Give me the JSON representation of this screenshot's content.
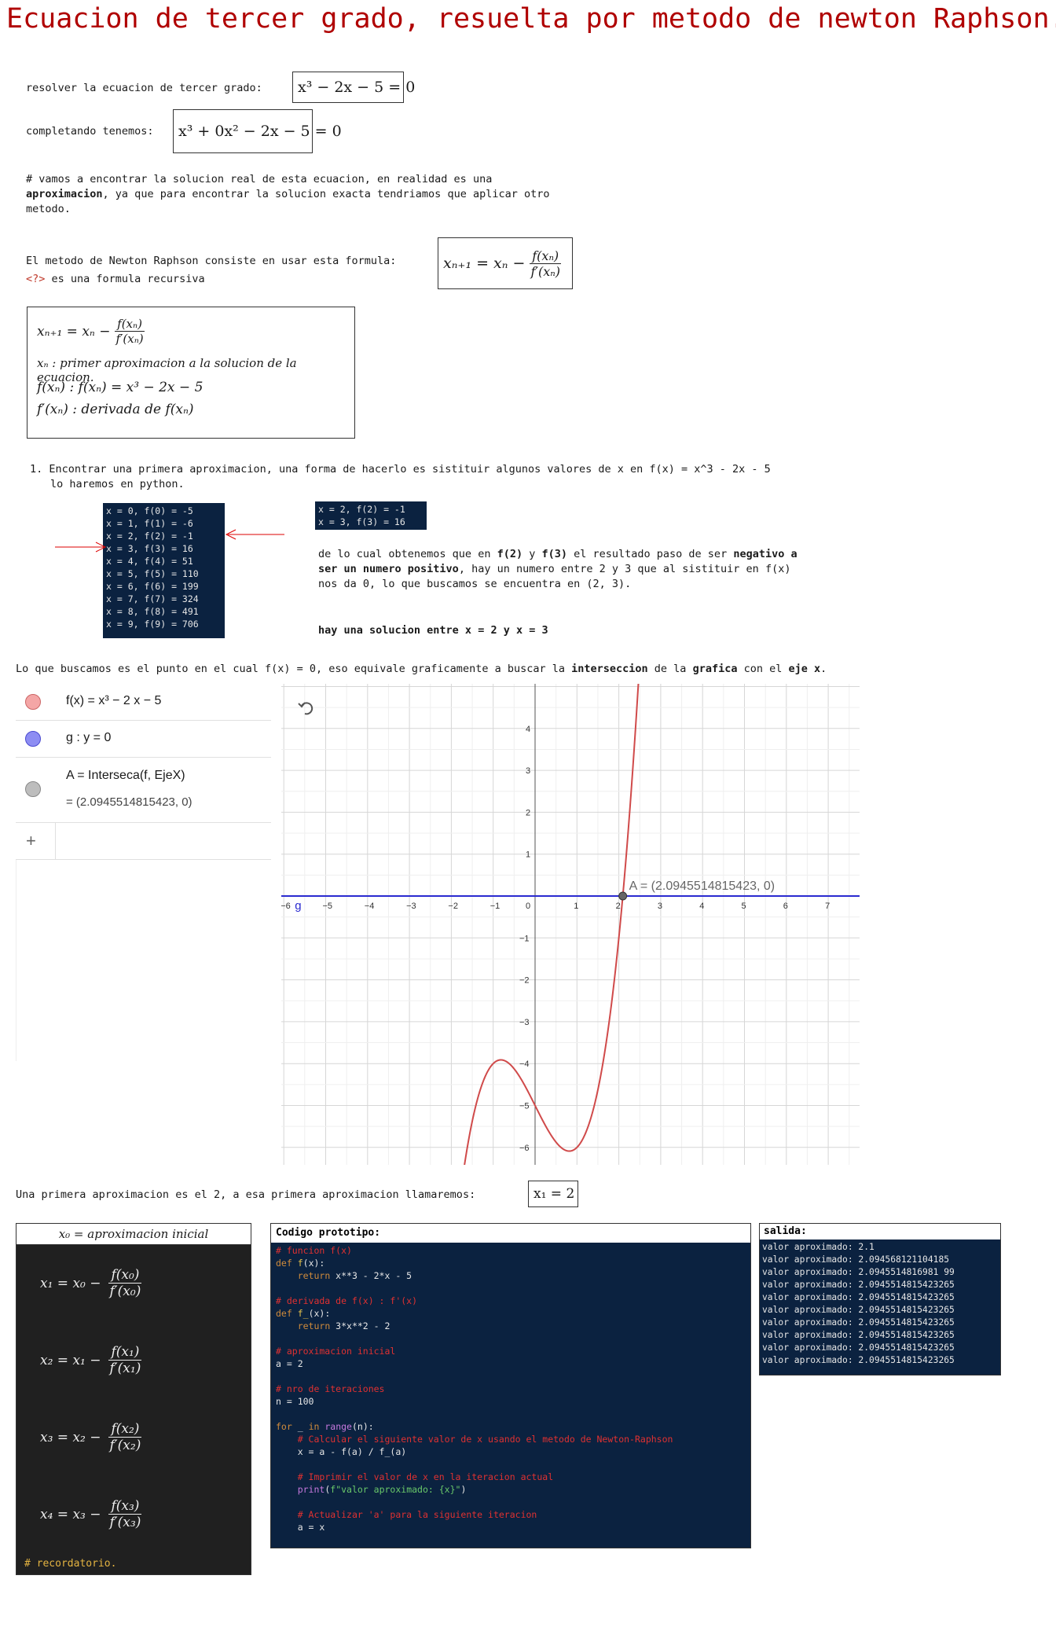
{
  "title": "Ecuacion de tercer grado, resuelta por metodo de newton Raphson.",
  "intro": {
    "resolver_label": "resolver la ecuacion de tercer grado:",
    "resolver_eq": "x³ − 2x − 5 = 0",
    "completando_label": "completando tenemos:",
    "completando_eq": "x³ + 0x² − 2x − 5 = 0",
    "note_line1": "# vamos a encontrar la solucion real de esta ecuacion, en realidad es una",
    "note_line2_bold": "aproximacion",
    "note_line2_rest": ", ya que para encontrar la solucion exacta tendriamos que aplicar otro",
    "note_line3": "metodo."
  },
  "newton": {
    "label": "El metodo de Newton Raphson consiste en usar esta formula:",
    "broken_icon": "<?>",
    "recursive": " es una formula recursiva",
    "formula_lhs": "xₙ₊₁ = xₙ −",
    "formula_num": "f(xₙ)",
    "formula_den": "f′(xₙ)",
    "box_line2": "xₙ : primer aproximacion a la solucion de la ecuacion.",
    "box_line3": "f(xₙ) : f(xₙ) = x³ − 2x − 5",
    "box_line4": "f′(xₙ) : derivada de f(xₙ)"
  },
  "step1": {
    "line1": "1. Encontrar una primera aproximacion, una forma de hacerlo es sistituir algunos valores de x en f(x) = x^3 - 2x - 5",
    "line2": "lo haremos en python.",
    "table_rows": [
      "x = 0, f(0) = -5",
      "x = 1, f(1) = -6",
      "x = 2, f(2) = -1",
      "x = 3, f(3) = 16",
      "x = 4, f(4) = 51",
      "x = 5, f(5) = 110",
      "x = 6, f(6) = 199",
      "x = 7, f(7) = 324",
      "x = 8, f(8) = 491",
      "x = 9, f(9) = 706"
    ],
    "mini_rows": [
      "x = 2, f(2) = -1",
      "x = 3, f(3) = 16"
    ],
    "expl_1a": "de lo cual obtenemos que en ",
    "expl_1b": "f(2)",
    "expl_1c": " y ",
    "expl_1d": "f(3)",
    "expl_1e": " el resultado paso de ser ",
    "expl_1f": "negativo a",
    "expl_2a": "ser un numero positivo",
    "expl_2b": ", hay un numero  entre 2 y 3 que al sistituir en f(x)",
    "expl_3": "nos da 0, lo que buscamos se encuentra en (2, 3).",
    "solution": "hay una solucion entre x = 2 y x = 3"
  },
  "graph_intro": {
    "a": "Lo que buscamos es el punto en el cual f(x) = 0, eso equivale graficamente a buscar la ",
    "b": "interseccion",
    "c": " de la ",
    "d": "grafica",
    "e": " con el ",
    "f": "eje x",
    "g": "."
  },
  "geogebra": {
    "f_expr": "f(x)  =  x³ − 2 x − 5",
    "g_expr": "g : y = 0",
    "a_expr": "A  =  Interseca(f, EjeX)",
    "a_value": "=  (2.0945514815423, 0)",
    "add": "+",
    "undo_icon": "undo-icon",
    "colors": {
      "f": "#e06666",
      "g": "#6c6cf0",
      "a": "#999999"
    },
    "point_label": "A = (2.0945514815423, 0)",
    "g_label": "g"
  },
  "chart_data": {
    "type": "line",
    "series": [
      {
        "name": "f",
        "expr": "x^3 - 2x - 5",
        "color": "#d04a4a"
      },
      {
        "name": "g",
        "expr": "y = 0",
        "color": "#2b2bd0"
      }
    ],
    "point": {
      "x": 2.0945514815423,
      "y": 0
    },
    "xlim": [
      -6.2,
      7.8
    ],
    "ylim": [
      -6.5,
      4.6
    ],
    "x_ticks": [
      -6,
      -5,
      -4,
      -3,
      -2,
      -1,
      0,
      1,
      2,
      3,
      4,
      5,
      6,
      7
    ],
    "y_ticks": [
      -6,
      -5,
      -4,
      -3,
      -2,
      -1,
      1,
      2,
      3,
      4
    ],
    "grid": true
  },
  "first_approx": {
    "text": "Una primera aproximacion es el 2, a esa primera aproximacion llamaremos:",
    "eq": "x₁ = 2"
  },
  "iter_panel": {
    "header": "x₀ = aproximacion inicial",
    "rows": [
      {
        "lhs": "x₁ = x₀ −",
        "num": "f(x₀)",
        "den": "f′(x₀)"
      },
      {
        "lhs": "x₂ = x₁ −",
        "num": "f(x₁)",
        "den": "f′(x₁)"
      },
      {
        "lhs": "x₃ = x₂ −",
        "num": "f(x₂)",
        "den": "f′(x₂)"
      },
      {
        "lhs": "x₄ = x₃ −",
        "num": "f(x₃)",
        "den": "f′(x₃)"
      }
    ],
    "footer": "# recordatorio."
  },
  "code_panel": {
    "header": "Codigo prototipo:"
  },
  "output_panel": {
    "header": "salida:",
    "lines": [
      "valor aproximado: 2.1",
      "valor aproximado: 2.094568121104185",
      "valor aproximado: 2.0945514816981 99",
      "valor aproximado: 2.0945514815423265",
      "valor aproximado: 2.0945514815423265",
      "valor aproximado: 2.0945514815423265",
      "valor aproximado: 2.0945514815423265",
      "valor aproximado: 2.0945514815423265",
      "valor aproximado: 2.0945514815423265",
      "valor aproximado: 2.0945514815423265"
    ]
  }
}
